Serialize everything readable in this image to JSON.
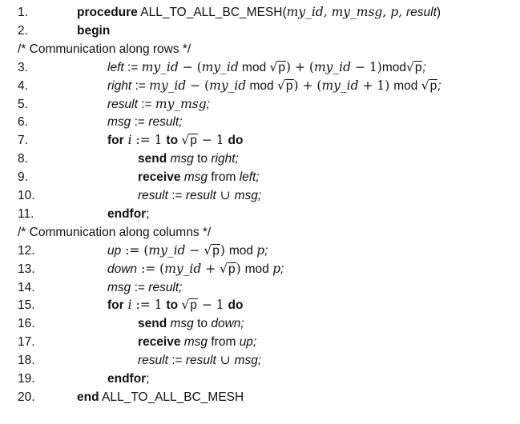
{
  "lines": [
    {
      "kind": "code",
      "num": "1.",
      "indent": 1,
      "segments": [
        {
          "t": "procedure",
          "s": "kw"
        },
        {
          "t": " ALL_TO_ALL_BC_MESH(",
          "s": ""
        },
        {
          "t": "my_id, my_msg, p, ",
          "s": "m"
        },
        {
          "t": "result",
          "s": "it"
        },
        {
          "t": ")",
          "s": ""
        }
      ]
    },
    {
      "kind": "code",
      "num": "2.",
      "indent": 1,
      "segments": [
        {
          "t": "begin",
          "s": "kw"
        }
      ]
    },
    {
      "kind": "comment",
      "text": "/* Communication along rows */"
    },
    {
      "kind": "code",
      "num": "3.",
      "indent": 2,
      "segments": [
        {
          "t": "left",
          "s": "it"
        },
        {
          "t": " := ",
          "s": ""
        },
        {
          "t": "my_id",
          "s": "m"
        },
        {
          "t": " − (",
          "s": "mr"
        },
        {
          "t": "my_id",
          "s": "m"
        },
        {
          "t": " mod ",
          "s": ""
        },
        {
          "t": "√",
          "s": "mr"
        },
        {
          "t": "p",
          "s": "sq"
        },
        {
          "t": ") + (",
          "s": "mr"
        },
        {
          "t": "my_id",
          "s": "m"
        },
        {
          "t": " − 1)",
          "s": "mr"
        },
        {
          "t": "mod",
          "s": ""
        },
        {
          "t": "√",
          "s": "mr"
        },
        {
          "t": "p",
          "s": "sq"
        },
        {
          "t": ";",
          "s": "it"
        }
      ]
    },
    {
      "kind": "code",
      "num": "4.",
      "indent": 2,
      "segments": [
        {
          "t": "right",
          "s": "it"
        },
        {
          "t": " := ",
          "s": ""
        },
        {
          "t": "my_id",
          "s": "m"
        },
        {
          "t": " − (",
          "s": "mr"
        },
        {
          "t": "my_id",
          "s": "m"
        },
        {
          "t": " mod ",
          "s": ""
        },
        {
          "t": "√",
          "s": "mr"
        },
        {
          "t": "p",
          "s": "sq"
        },
        {
          "t": ") + (",
          "s": "mr"
        },
        {
          "t": "my_id",
          "s": "m"
        },
        {
          "t": " + 1) ",
          "s": "mr"
        },
        {
          "t": "mod ",
          "s": ""
        },
        {
          "t": "√",
          "s": "mr"
        },
        {
          "t": "p",
          "s": "sq"
        },
        {
          "t": ";",
          "s": "it"
        }
      ]
    },
    {
      "kind": "code",
      "num": "5.",
      "indent": 2,
      "segments": [
        {
          "t": "result",
          "s": "it"
        },
        {
          "t": " := ",
          "s": ""
        },
        {
          "t": "my_msg",
          "s": "m"
        },
        {
          "t": ";",
          "s": "it"
        }
      ]
    },
    {
      "kind": "code",
      "num": "6.",
      "indent": 2,
      "segments": [
        {
          "t": "msg",
          "s": "it"
        },
        {
          "t": " := ",
          "s": ""
        },
        {
          "t": "result",
          "s": "it"
        },
        {
          "t": ";",
          "s": "it"
        }
      ]
    },
    {
      "kind": "code",
      "num": "7.",
      "indent": 2,
      "segments": [
        {
          "t": "for",
          "s": "kw"
        },
        {
          "t": " i",
          "s": "m"
        },
        {
          "t": " := 1 ",
          "s": "mr"
        },
        {
          "t": "to",
          "s": "kw"
        },
        {
          "t": " ",
          "s": ""
        },
        {
          "t": "√",
          "s": "mr"
        },
        {
          "t": "p",
          "s": "sq"
        },
        {
          "t": " − 1 ",
          "s": "mr"
        },
        {
          "t": "do",
          "s": "kw"
        }
      ]
    },
    {
      "kind": "code",
      "num": "8.",
      "indent": 3,
      "segments": [
        {
          "t": "send",
          "s": "kw"
        },
        {
          "t": " ",
          "s": ""
        },
        {
          "t": "msg",
          "s": "it"
        },
        {
          "t": " to ",
          "s": ""
        },
        {
          "t": "right;",
          "s": "it"
        }
      ]
    },
    {
      "kind": "code",
      "num": "9.",
      "indent": 3,
      "segments": [
        {
          "t": "receive",
          "s": "kw"
        },
        {
          "t": " ",
          "s": ""
        },
        {
          "t": "msg",
          "s": "it"
        },
        {
          "t": " from ",
          "s": ""
        },
        {
          "t": "left;",
          "s": "it"
        }
      ]
    },
    {
      "kind": "code",
      "num": "10.",
      "indent": 3,
      "segments": [
        {
          "t": "result",
          "s": "it"
        },
        {
          "t": " := ",
          "s": ""
        },
        {
          "t": "result",
          "s": "it"
        },
        {
          "t": " ∪ ",
          "s": "mr"
        },
        {
          "t": "msg;",
          "s": "it"
        }
      ]
    },
    {
      "kind": "code",
      "num": "11.",
      "indent": 2,
      "segments": [
        {
          "t": "endfor",
          "s": "kw"
        },
        {
          "t": ";",
          "s": ""
        }
      ]
    },
    {
      "kind": "comment",
      "text": "/* Communication along columns */"
    },
    {
      "kind": "code",
      "num": "12.",
      "indent": 2,
      "segments": [
        {
          "t": "up",
          "s": "it"
        },
        {
          "t": " := (",
          "s": "mr"
        },
        {
          "t": "my_id",
          "s": "m"
        },
        {
          "t": " − ",
          "s": "mr"
        },
        {
          "t": "√",
          "s": "mr"
        },
        {
          "t": "p",
          "s": "sq"
        },
        {
          "t": ") ",
          "s": "mr"
        },
        {
          "t": "mod ",
          "s": ""
        },
        {
          "t": "p",
          "s": "m"
        },
        {
          "t": ";",
          "s": "it"
        }
      ]
    },
    {
      "kind": "code",
      "num": "13.",
      "indent": 2,
      "segments": [
        {
          "t": "down",
          "s": "it"
        },
        {
          "t": " := (",
          "s": "mr"
        },
        {
          "t": "my_id",
          "s": "m"
        },
        {
          "t": " + ",
          "s": "mr"
        },
        {
          "t": "√",
          "s": "mr"
        },
        {
          "t": "p",
          "s": "sq"
        },
        {
          "t": ") ",
          "s": "mr"
        },
        {
          "t": "mod ",
          "s": ""
        },
        {
          "t": "p",
          "s": "m"
        },
        {
          "t": ";",
          "s": "it"
        }
      ]
    },
    {
      "kind": "code",
      "num": "14.",
      "indent": 2,
      "segments": [
        {
          "t": "msg",
          "s": "it"
        },
        {
          "t": " := ",
          "s": ""
        },
        {
          "t": "result;",
          "s": "it"
        }
      ]
    },
    {
      "kind": "code",
      "num": "15.",
      "indent": 2,
      "segments": [
        {
          "t": "for",
          "s": "kw"
        },
        {
          "t": " i",
          "s": "m"
        },
        {
          "t": " := 1 ",
          "s": "mr"
        },
        {
          "t": "to",
          "s": "kw"
        },
        {
          "t": " ",
          "s": ""
        },
        {
          "t": "√",
          "s": "mr"
        },
        {
          "t": "p",
          "s": "sq"
        },
        {
          "t": " − 1 ",
          "s": "mr"
        },
        {
          "t": "do",
          "s": "kw"
        }
      ]
    },
    {
      "kind": "code",
      "num": "16.",
      "indent": 3,
      "segments": [
        {
          "t": "send",
          "s": "kw"
        },
        {
          "t": " ",
          "s": ""
        },
        {
          "t": "msg",
          "s": "it"
        },
        {
          "t": " to ",
          "s": ""
        },
        {
          "t": "down;",
          "s": "it"
        }
      ]
    },
    {
      "kind": "code",
      "num": "17.",
      "indent": 3,
      "segments": [
        {
          "t": "receive",
          "s": "kw"
        },
        {
          "t": " ",
          "s": ""
        },
        {
          "t": "msg",
          "s": "it"
        },
        {
          "t": " from ",
          "s": ""
        },
        {
          "t": "up;",
          "s": "it"
        }
      ]
    },
    {
      "kind": "code",
      "num": "18.",
      "indent": 3,
      "segments": [
        {
          "t": "result",
          "s": "it"
        },
        {
          "t": " := ",
          "s": ""
        },
        {
          "t": "result",
          "s": "it"
        },
        {
          "t": " ∪ ",
          "s": "mr"
        },
        {
          "t": "msg;",
          "s": "it"
        }
      ]
    },
    {
      "kind": "code",
      "num": "19.",
      "indent": 2,
      "segments": [
        {
          "t": "endfor",
          "s": "kw"
        },
        {
          "t": ";",
          "s": ""
        }
      ]
    },
    {
      "kind": "code",
      "num": "20.",
      "indent": 1,
      "segments": [
        {
          "t": "end",
          "s": "kw"
        },
        {
          "t": " ALL_TO_ALL_BC_MESH",
          "s": ""
        }
      ]
    }
  ]
}
